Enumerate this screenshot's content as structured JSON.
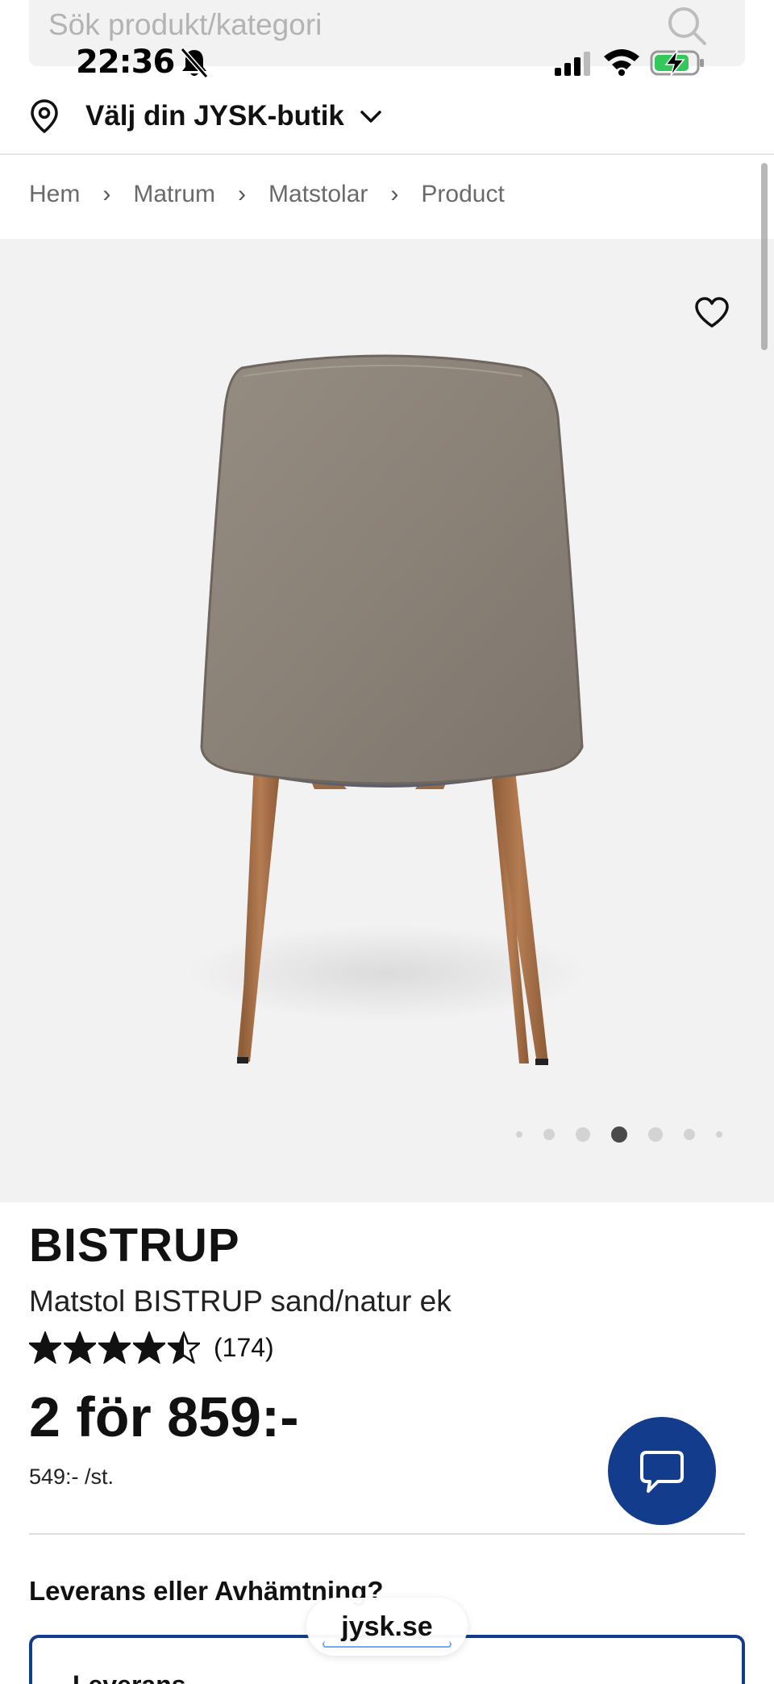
{
  "search": {
    "placeholder": "Sök produkt/kategori"
  },
  "status_bar": {
    "time": "22:36"
  },
  "store_selector": {
    "label": "Välj din JYSK-butik"
  },
  "breadcrumb": [
    "Hem",
    "Matrum",
    "Matstolar",
    "Product"
  ],
  "gallery": {
    "image_count": 7,
    "active_index": 3
  },
  "product": {
    "brand": "BISTRUP",
    "name": "Matstol BISTRUP sand/natur ek",
    "rating": 4.5,
    "review_count": "(174)",
    "price": "2 för 859:-",
    "unit_price": "549:- /st."
  },
  "delivery": {
    "heading": "Leverans eller Avhämtning?",
    "option_label": "Leverans"
  },
  "browser": {
    "url": "jysk.se"
  },
  "colors": {
    "brand_blue": "#143c8c",
    "image_bg": "#f3f2f3"
  }
}
